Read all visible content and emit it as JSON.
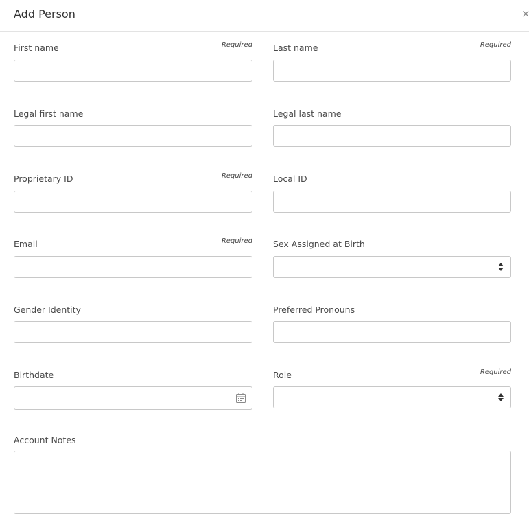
{
  "modal": {
    "title": "Add Person",
    "close_symbol": "×"
  },
  "required_text": "Required",
  "fields": {
    "first_name": {
      "label": "First name",
      "value": "",
      "required": true
    },
    "last_name": {
      "label": "Last name",
      "value": "",
      "required": true
    },
    "legal_first_name": {
      "label": "Legal first name",
      "value": "",
      "required": false
    },
    "legal_last_name": {
      "label": "Legal last name",
      "value": "",
      "required": false
    },
    "proprietary_id": {
      "label": "Proprietary ID",
      "value": "",
      "required": true
    },
    "local_id": {
      "label": "Local ID",
      "value": "",
      "required": false
    },
    "email": {
      "label": "Email",
      "value": "",
      "required": true
    },
    "sex_assigned_at_birth": {
      "label": "Sex Assigned at Birth",
      "value": "",
      "required": false,
      "type": "select"
    },
    "gender_identity": {
      "label": "Gender Identity",
      "value": "",
      "required": false
    },
    "preferred_pronouns": {
      "label": "Preferred Pronouns",
      "value": "",
      "required": false
    },
    "birthdate": {
      "label": "Birthdate",
      "value": "",
      "required": false,
      "icon": "calendar-icon"
    },
    "role": {
      "label": "Role",
      "value": "",
      "required": true,
      "type": "select"
    },
    "account_notes": {
      "label": "Account Notes",
      "value": "",
      "required": false,
      "type": "textarea"
    }
  },
  "colors": {
    "border": "#c8c8c8",
    "divider": "#e3e3e3",
    "text": "#333333"
  }
}
